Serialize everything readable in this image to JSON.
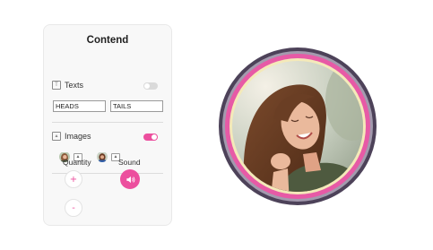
{
  "panel": {
    "title": "Contend",
    "texts": {
      "label": "Texts",
      "icon": "text-icon",
      "toggle_on": false,
      "heads_value": "HEADS",
      "tails_value": "TAILS"
    },
    "images": {
      "label": "Images",
      "icon": "image-icon",
      "toggle_on": true,
      "upload_icon": "upload-icon"
    },
    "quantity": {
      "label": "Quantity",
      "plus": "+",
      "minus": "-"
    },
    "sound": {
      "label": "Sound",
      "icon": "speaker-icon"
    }
  },
  "colors": {
    "accent": "#ec4f9e",
    "coin_outer_ring": "#4d4259",
    "coin_inner_ring": "#e75aa6"
  }
}
